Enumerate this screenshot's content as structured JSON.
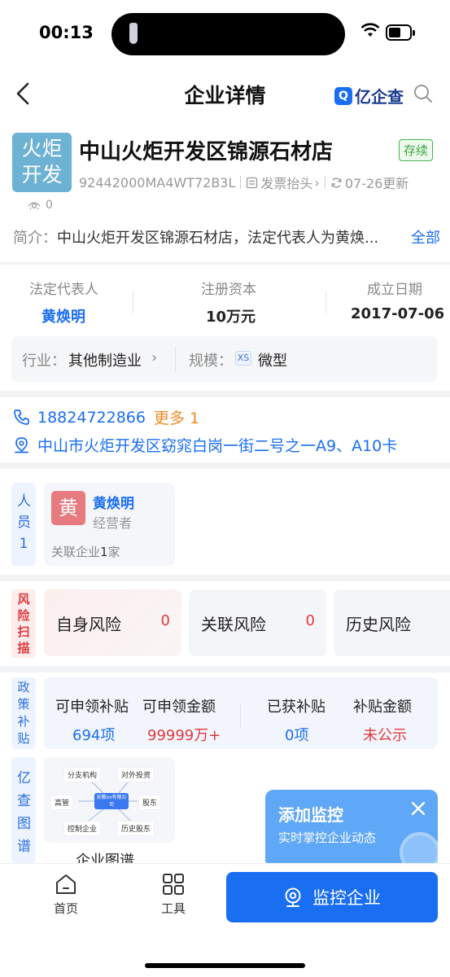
{
  "status_bar": {
    "time": "00:13"
  },
  "nav": {
    "title": "企业详情",
    "brand": "亿企查",
    "brand_mark": "Q"
  },
  "company": {
    "logo_line1": "火炬",
    "logo_line2": "开发",
    "name": "中山火炬开发区锦源石材店",
    "status": "存续",
    "credit_code": "92442000MA4WT72B3L",
    "invoice_label": "发票抬头",
    "updated": "07-26更新",
    "views": "0",
    "intro_label": "简介：",
    "intro_text": "中山火炬开发区锦源石材店，法定代表人为黄焕...",
    "intro_more": "全部"
  },
  "basic_info": {
    "legal_rep_label": "法定代表人",
    "legal_rep": "黄焕明",
    "capital_label": "注册资本",
    "capital": "10万元",
    "founded_label": "成立日期",
    "founded": "2017-07-06",
    "industry_label": "行业：",
    "industry": "其他制造业",
    "scale_label": "规模：",
    "scale_badge": "XS",
    "scale": "微型"
  },
  "contact": {
    "phone": "18824722866",
    "phone_more": "更多 1",
    "address": "中山市火炬开发区窈窕白岗一街二号之一A9、A10卡"
  },
  "people": {
    "tab_label": "人员",
    "tab_count": "1",
    "avatar_char": "黄",
    "name": "黄焕明",
    "role": "经营者",
    "related_prefix": "关联企业",
    "related_count": "1",
    "related_suffix": "家"
  },
  "risk": {
    "tab_label": "风险扫描",
    "items": [
      {
        "label": "自身风险",
        "count": "0"
      },
      {
        "label": "关联风险",
        "count": "0"
      },
      {
        "label": "历史风险",
        "count": ""
      }
    ]
  },
  "subsidy": {
    "tab_label": "政策补贴",
    "applicable_label": "可申领补贴",
    "applicable_value": "694项",
    "amount_label": "可申领金额",
    "amount_value": "99999万+",
    "obtained_label": "已获补贴",
    "obtained_value": "0项",
    "obtained_amount_label": "补贴金额",
    "obtained_amount_value": "未公示"
  },
  "graph": {
    "tab_label": "亿查图谱",
    "nodes": [
      "分支机构",
      "对外投资",
      "高管",
      "股东",
      "控制企业",
      "历史股东"
    ],
    "center": "安徽xx有限公司",
    "label": "企业图谱"
  },
  "monitor_popup": {
    "title": "添加监控",
    "subtitle": "实时掌控企业动态"
  },
  "bottom_bar": {
    "home": "首页",
    "tools": "工具",
    "monitor": "监控企业"
  },
  "colors": {
    "accent": "#1a6ef2",
    "risk_red": "#e03a3e",
    "warn_orange": "#f08a24",
    "status_green": "#3ca640"
  }
}
